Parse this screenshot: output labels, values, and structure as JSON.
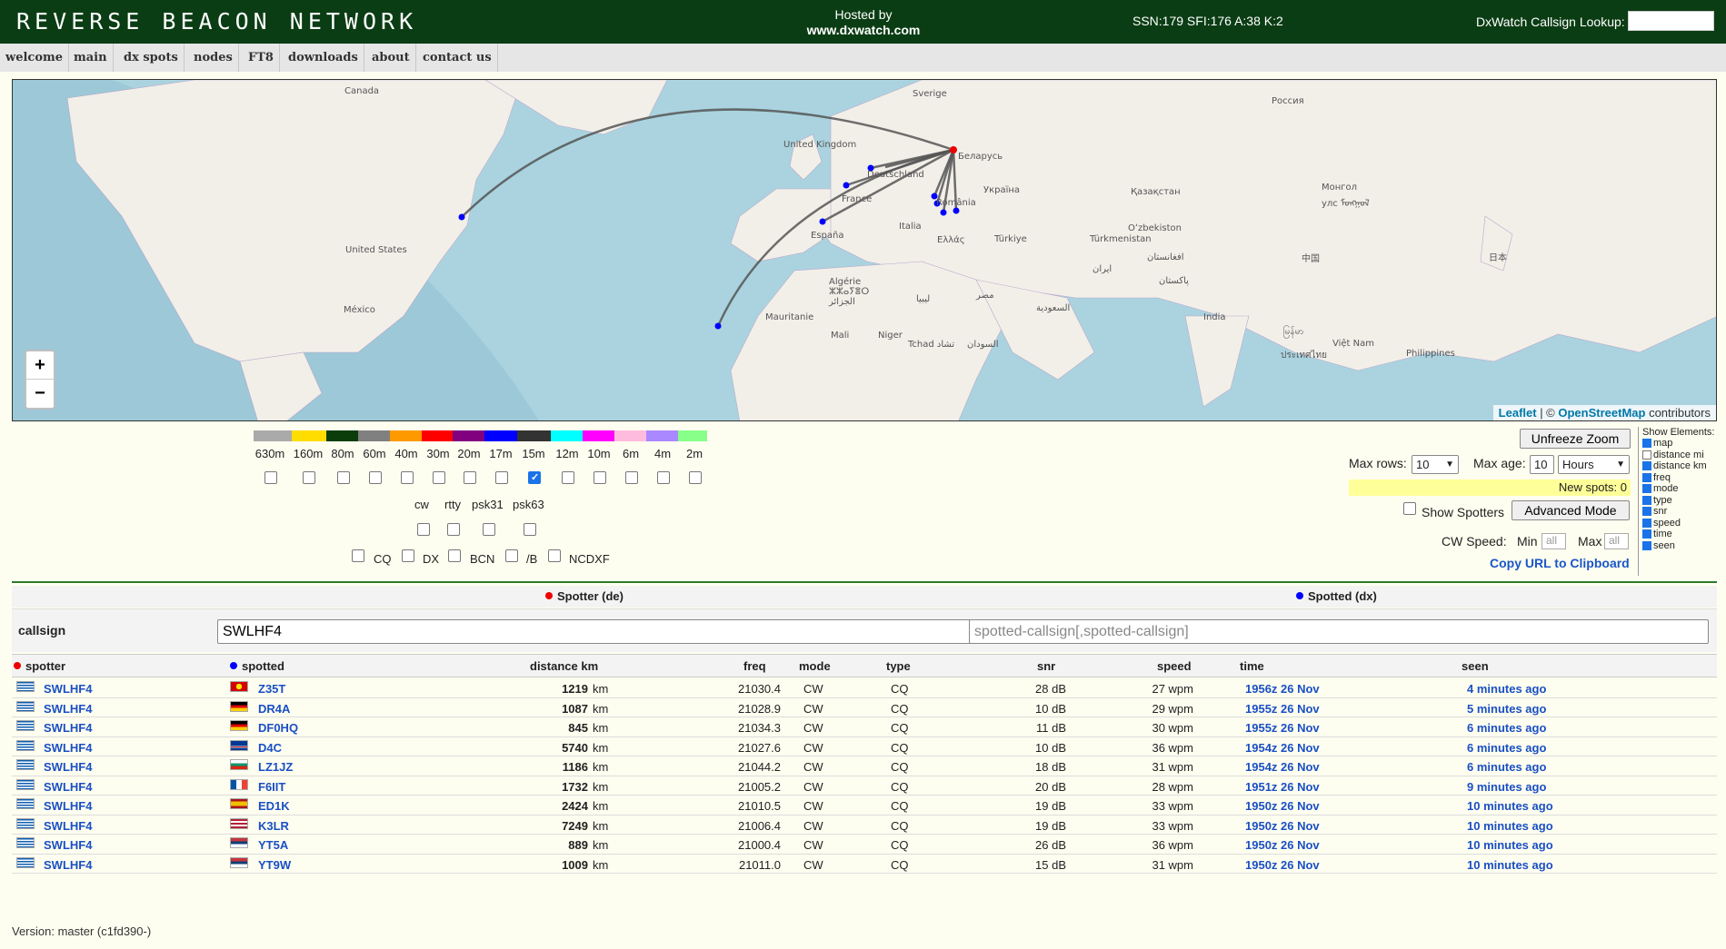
{
  "header": {
    "logo": "REVERSE BEACON NETWORK",
    "hosted_by": "Hosted by",
    "host_url": "www.dxwatch.com",
    "solar": "SSN:179 SFI:176 A:38 K:2",
    "lookup_label": "DxWatch Callsign Lookup:"
  },
  "nav": [
    "welcome",
    "main",
    "dx spots",
    "nodes",
    "FT8",
    "downloads",
    "about",
    "contact us"
  ],
  "map": {
    "zoom_in": "+",
    "zoom_out": "−",
    "attribution_leaflet": "Leaflet",
    "attribution_sep": " | © ",
    "attribution_osm": "OpenStreetMap",
    "attribution_tail": " contributors",
    "labels": [
      "Canada",
      "Sverige",
      "Россия",
      "United Kingdom",
      "Беларусь",
      "Deutschland",
      "France",
      "Україна",
      "Қазақстан",
      "Монгол улс ᠮᠣᠩᠭᠣᠯ",
      "România",
      "Italia",
      "España",
      "Oʻzbekiston",
      "Türkiye",
      "Türkmenistan",
      "Ελλάς",
      "United States",
      "中国",
      "日本",
      "Algérie ⵣⵣⴰⵢⴻⵔ الجزائر",
      "ليبيا",
      "مصر",
      "ایران",
      "افغانستان",
      "پاکستان",
      "México",
      "Mauritanie",
      "Mali",
      "Niger",
      "Tchad تشاد",
      "السودان",
      "السعودية",
      "India",
      "မြန်မာ",
      "Việt Nam",
      "Philippines",
      "ประเทศไทย"
    ]
  },
  "bands": {
    "labels": [
      "630m",
      "160m",
      "80m",
      "60m",
      "40m",
      "30m",
      "20m",
      "17m",
      "15m",
      "12m",
      "10m",
      "6m",
      "4m",
      "2m"
    ],
    "colors": [
      "#aaaaaa",
      "#ffdd00",
      "#0b3d0b",
      "#808080",
      "#ff9900",
      "#ff0000",
      "#800080",
      "#0000ff",
      "#333333",
      "#00ffff",
      "#ff00ff",
      "#ffbbdd",
      "#aa88ff",
      "#88ff88"
    ],
    "checked": [
      false,
      false,
      false,
      false,
      false,
      false,
      false,
      false,
      true,
      false,
      false,
      false,
      false,
      false
    ]
  },
  "modes": {
    "labels": [
      "cw",
      "rtty",
      "psk31",
      "psk63"
    ]
  },
  "types": {
    "labels": [
      "CQ",
      "DX",
      "BCN",
      "/B",
      "NCDXF"
    ]
  },
  "controls": {
    "unfreeze": "Unfreeze Zoom",
    "max_rows_label": "Max rows:",
    "max_rows_value": "10",
    "max_age_label": "Max age:",
    "max_age_value": "10",
    "max_age_unit": "Hours",
    "new_spots": "New spots: 0",
    "show_spotters": "Show Spotters",
    "advanced": "Advanced Mode",
    "cw_speed": "CW Speed:",
    "min_label": "Min",
    "max_label": "Max",
    "min_placeholder": "all",
    "max_placeholder": "all",
    "copy_url": "Copy URL to Clipboard"
  },
  "show_elements": {
    "title": "Show Elements:",
    "items": [
      {
        "label": "map",
        "on": true
      },
      {
        "label": "distance mi",
        "on": false
      },
      {
        "label": "distance km",
        "on": true
      },
      {
        "label": "freq",
        "on": true
      },
      {
        "label": "mode",
        "on": true
      },
      {
        "label": "type",
        "on": true
      },
      {
        "label": "snr",
        "on": true
      },
      {
        "label": "speed",
        "on": true
      },
      {
        "label": "time",
        "on": true
      },
      {
        "label": "seen",
        "on": true
      }
    ]
  },
  "filter": {
    "spotter_head": "Spotter (de)",
    "spotted_head": "Spotted (dx)",
    "callsign_label": "callsign",
    "spotter_value": "SWLHF4",
    "spotted_placeholder": "spotted-callsign[,spotted-callsign]"
  },
  "table": {
    "headers": {
      "spotter": "spotter",
      "spotted": "spotted",
      "distance": "distance km",
      "freq": "freq",
      "mode": "mode",
      "type": "type",
      "snr": "snr",
      "speed": "speed",
      "time": "time",
      "seen": "seen"
    },
    "rows": [
      {
        "spotter": "SWLHF4",
        "spotted": "Z35T",
        "dist": "1219",
        "unit": "km",
        "freq": "21030.4",
        "mode": "CW",
        "type": "CQ",
        "snr": "28 dB",
        "speed": "27 wpm",
        "time": "1956z 26 Nov",
        "seen": "4 minutes ago",
        "flag": "mk"
      },
      {
        "spotter": "SWLHF4",
        "spotted": "DR4A",
        "dist": "1087",
        "unit": "km",
        "freq": "21028.9",
        "mode": "CW",
        "type": "CQ",
        "snr": "10 dB",
        "speed": "29 wpm",
        "time": "1955z 26 Nov",
        "seen": "5 minutes ago",
        "flag": "de"
      },
      {
        "spotter": "SWLHF4",
        "spotted": "DF0HQ",
        "dist": "845",
        "unit": "km",
        "freq": "21034.3",
        "mode": "CW",
        "type": "CQ",
        "snr": "11 dB",
        "speed": "30 wpm",
        "time": "1955z 26 Nov",
        "seen": "6 minutes ago",
        "flag": "de"
      },
      {
        "spotter": "SWLHF4",
        "spotted": "D4C",
        "dist": "5740",
        "unit": "km",
        "freq": "21027.6",
        "mode": "CW",
        "type": "CQ",
        "snr": "10 dB",
        "speed": "36 wpm",
        "time": "1954z 26 Nov",
        "seen": "6 minutes ago",
        "flag": "cv"
      },
      {
        "spotter": "SWLHF4",
        "spotted": "LZ1JZ",
        "dist": "1186",
        "unit": "km",
        "freq": "21044.2",
        "mode": "CW",
        "type": "CQ",
        "snr": "18 dB",
        "speed": "31 wpm",
        "time": "1954z 26 Nov",
        "seen": "6 minutes ago",
        "flag": "bg"
      },
      {
        "spotter": "SWLHF4",
        "spotted": "F6IIT",
        "dist": "1732",
        "unit": "km",
        "freq": "21005.2",
        "mode": "CW",
        "type": "CQ",
        "snr": "20 dB",
        "speed": "28 wpm",
        "time": "1951z 26 Nov",
        "seen": "9 minutes ago",
        "flag": "fr"
      },
      {
        "spotter": "SWLHF4",
        "spotted": "ED1K",
        "dist": "2424",
        "unit": "km",
        "freq": "21010.5",
        "mode": "CW",
        "type": "CQ",
        "snr": "19 dB",
        "speed": "33 wpm",
        "time": "1950z 26 Nov",
        "seen": "10 minutes ago",
        "flag": "es"
      },
      {
        "spotter": "SWLHF4",
        "spotted": "K3LR",
        "dist": "7249",
        "unit": "km",
        "freq": "21006.4",
        "mode": "CW",
        "type": "CQ",
        "snr": "19 dB",
        "speed": "33 wpm",
        "time": "1950z 26 Nov",
        "seen": "10 minutes ago",
        "flag": "us"
      },
      {
        "spotter": "SWLHF4",
        "spotted": "YT5A",
        "dist": "889",
        "unit": "km",
        "freq": "21000.4",
        "mode": "CW",
        "type": "CQ",
        "snr": "26 dB",
        "speed": "36 wpm",
        "time": "1950z 26 Nov",
        "seen": "10 minutes ago",
        "flag": "rs"
      },
      {
        "spotter": "SWLHF4",
        "spotted": "YT9W",
        "dist": "1009",
        "unit": "km",
        "freq": "21011.0",
        "mode": "CW",
        "type": "CQ",
        "snr": "15 dB",
        "speed": "31 wpm",
        "time": "1950z 26 Nov",
        "seen": "10 minutes ago",
        "flag": "rs"
      }
    ]
  },
  "footer": {
    "version": "Version: master (c1fd390-)"
  },
  "colors": {
    "header_bg": "#0b3d14",
    "link": "#1a4fc4",
    "spotter_dot": "#ee0000",
    "spotted_dot": "#0000ff",
    "divider": "#2b7a2b"
  }
}
